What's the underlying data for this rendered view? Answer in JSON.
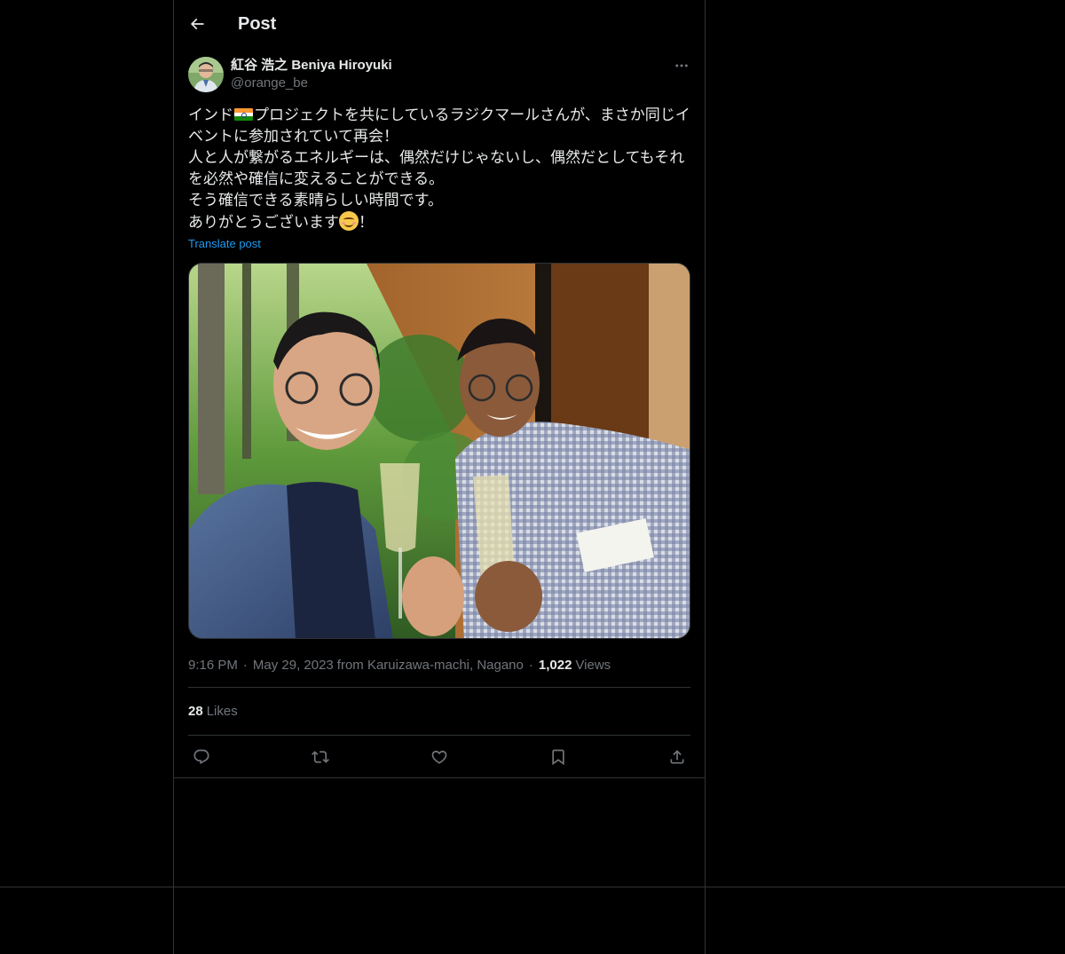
{
  "header": {
    "title": "Post"
  },
  "author": {
    "display_name": "紅谷 浩之 Beniya Hiroyuki",
    "handle": "@orange_be"
  },
  "post": {
    "lines": [
      {
        "before": "インド",
        "flag": "india-flag-emoji",
        "after": "プロジェクトを共にしているラジクマールさんが、まさか同じイ"
      },
      {
        "text": "ベントに参加されていて再会！"
      },
      {
        "text": "人と人が繋がるエネルギーは、偶然だけじゃないし、偶然だとしてもそれ"
      },
      {
        "text": "を必然や確信に変えることができる。"
      },
      {
        "text": "そう確信できる素晴らしい時間です。"
      },
      {
        "before": "ありがとうございます",
        "emoji": "smiling-face-emoji",
        "after": "！"
      }
    ],
    "translate_label": "Translate post"
  },
  "meta": {
    "time": "9:16 PM",
    "date": "May 29, 2023",
    "location": "from Karuizawa-machi, Nagano",
    "views_count": "1,022",
    "views_label": "Views",
    "separator": "·"
  },
  "stats": {
    "likes_count": "28",
    "likes_label": "Likes"
  },
  "actions": [
    "reply-icon",
    "repost-icon",
    "like-icon",
    "bookmark-icon",
    "share-icon"
  ],
  "colors": {
    "background": "#000000",
    "text": "#e7e9ea",
    "muted": "#71767b",
    "link": "#1d9bf0",
    "border": "#2f3336"
  }
}
